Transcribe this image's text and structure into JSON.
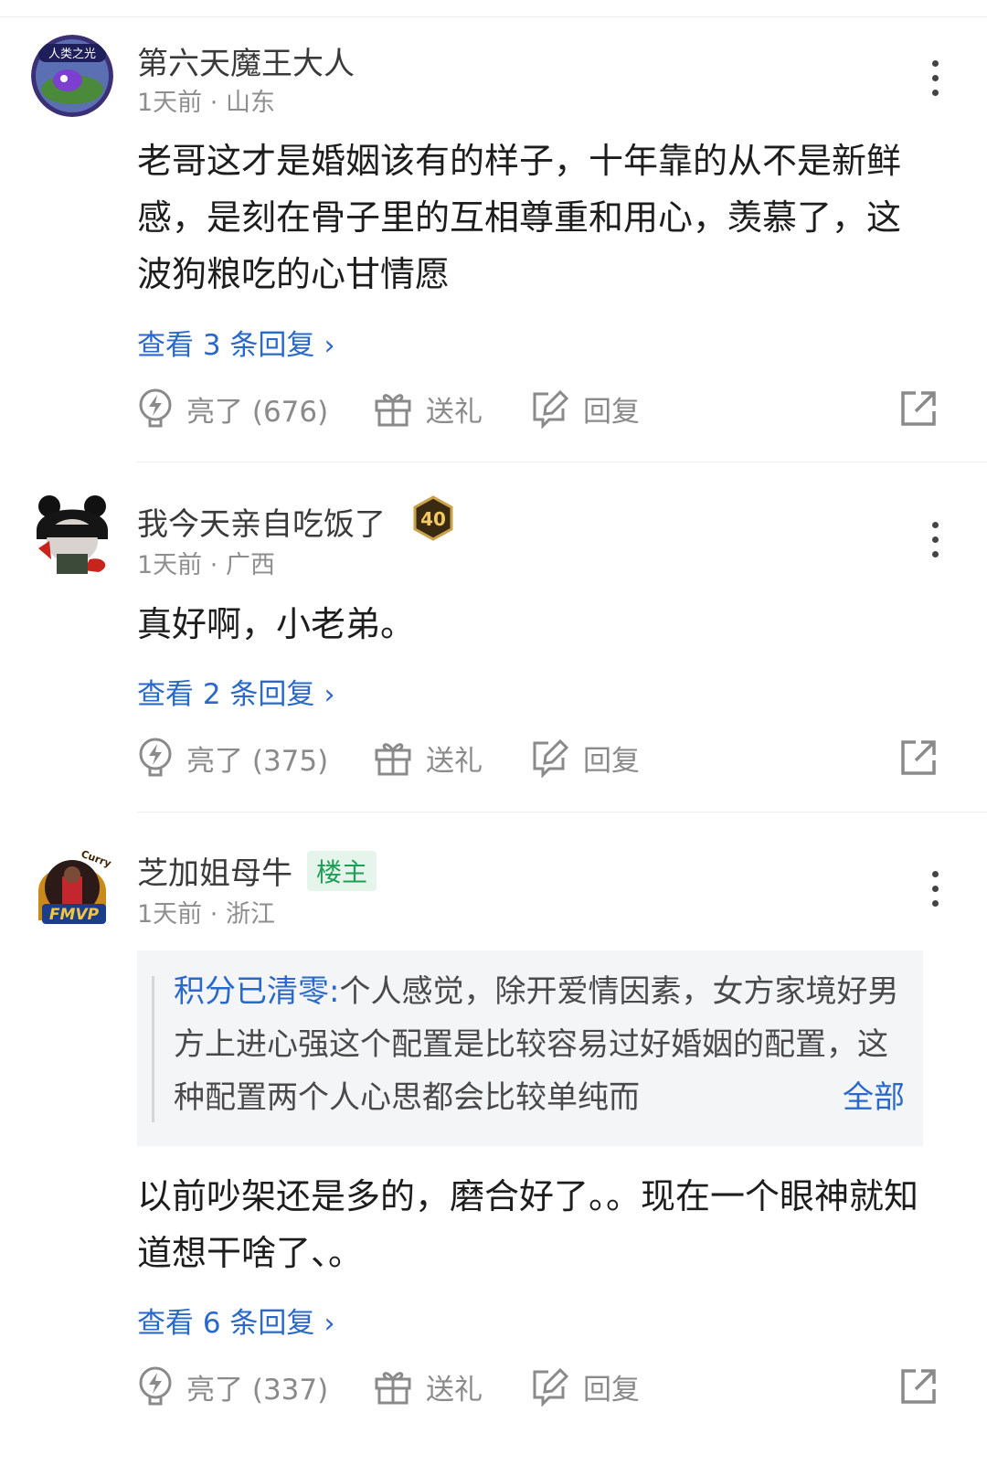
{
  "comments": [
    {
      "username": "第六天魔王大人",
      "time": "1天前",
      "location": "山东",
      "text": "老哥这才是婚姻该有的样子，十年靠的从不是新鲜感，是刻在骨子里的互相尊重和用心，羡慕了，这波狗粮吃的心甘情愿",
      "replies_label": "查看 3 条回复",
      "like_label": "亮了 (676)",
      "gift_label": "送礼",
      "reply_label": "回复",
      "avatar_text": "人类之光"
    },
    {
      "username": "我今天亲自吃饭了",
      "level": "40",
      "time": "1天前",
      "location": "广西",
      "text": "真好啊，小老弟。",
      "replies_label": "查看 2 条回复",
      "like_label": "亮了 (375)",
      "gift_label": "送礼",
      "reply_label": "回复"
    },
    {
      "username": "芝加姐母牛",
      "owner_tag": "楼主",
      "time": "1天前",
      "location": "浙江",
      "quote_author": "积分已清零:",
      "quote_text": "个人感觉，除开爱情因素，女方家境好男方上进心强这个配置是比较容易过好婚姻的配置，这种配置两个人心思都会比较单纯而",
      "quote_more": "全部",
      "text": "以前吵架还是多的，磨合好了。。现在一个眼神就知道想干啥了、。",
      "replies_label": "查看 6 条回复",
      "like_label": "亮了 (337)",
      "gift_label": "送礼",
      "reply_label": "回复",
      "avatar_text_top": "Curry",
      "avatar_text_bottom": "FMVP"
    }
  ],
  "separator": "·",
  "colors": {
    "link_blue": "#2a68c9",
    "owner_green": "#1f9e57",
    "meta_gray": "#8e8e8e"
  }
}
